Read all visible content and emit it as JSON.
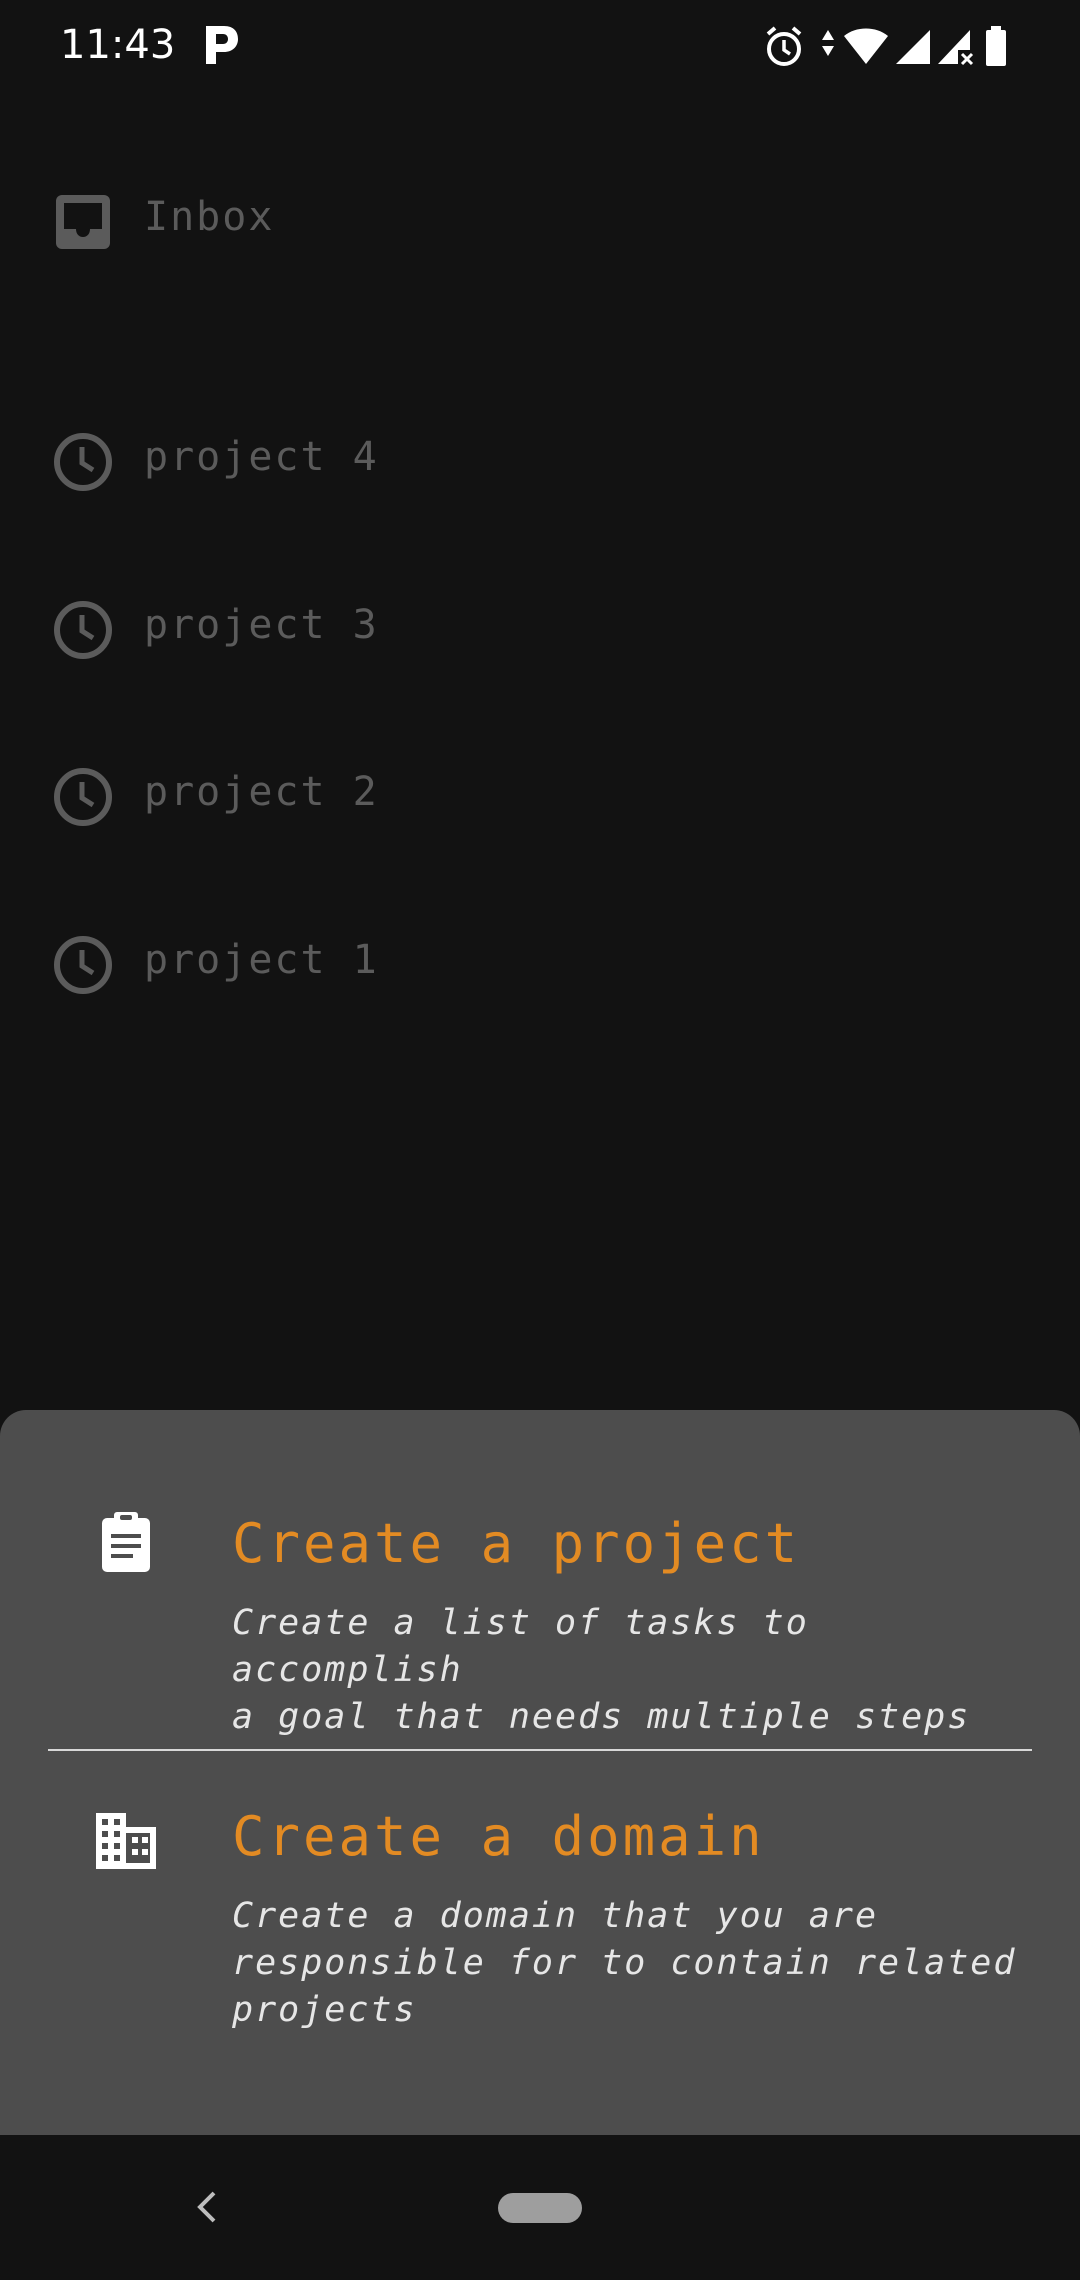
{
  "status_bar": {
    "time": "11:43",
    "icons": [
      "p-app-icon",
      "alarm-icon",
      "data-arrows-icon",
      "wifi-icon",
      "signal-icon",
      "signal-no-data-icon",
      "battery-icon"
    ]
  },
  "list": {
    "items": [
      {
        "label": "Inbox",
        "icon": "inbox-icon"
      },
      {
        "label": "project 4",
        "icon": "clock-icon"
      },
      {
        "label": "project 3",
        "icon": "clock-icon"
      },
      {
        "label": "project 2",
        "icon": "clock-icon"
      },
      {
        "label": "project 1",
        "icon": "clock-icon"
      }
    ]
  },
  "sheet": {
    "options": [
      {
        "title": "Create a project",
        "description_lines": [
          "Create a list of tasks to accomplish",
          "a goal that needs multiple steps"
        ],
        "icon": "clipboard-icon"
      },
      {
        "title": "Create a domain",
        "description_lines": [
          "Create a domain that you are",
          "responsible for to contain related",
          "projects"
        ],
        "icon": "building-icon"
      }
    ]
  },
  "colors": {
    "background": "#121212",
    "sheet": "#4d4d4d",
    "accent": "#e38b23",
    "dimmed_text": "#5b5b5b"
  },
  "navbar": {
    "icons": [
      "back-icon",
      "home-pill"
    ]
  }
}
